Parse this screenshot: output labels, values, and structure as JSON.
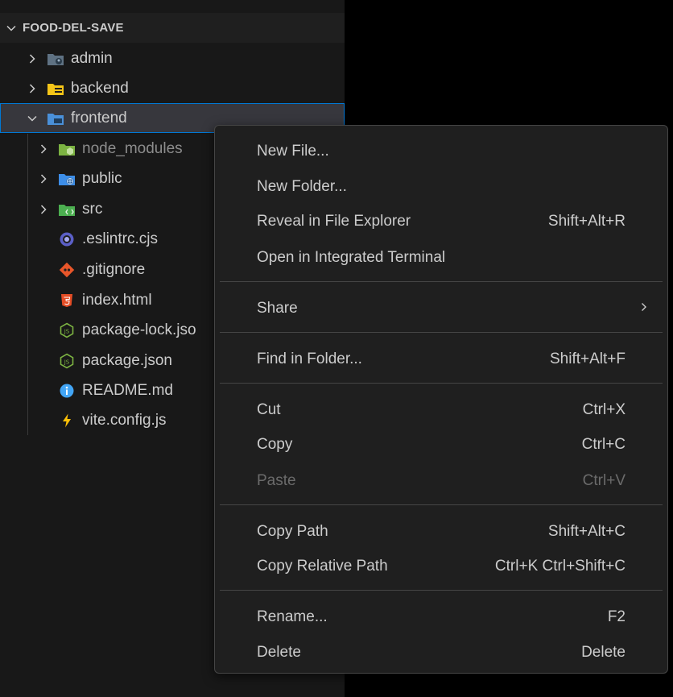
{
  "explorer": {
    "root_label": "FOOD-DEL-SAVE",
    "items": [
      {
        "label": "admin",
        "icon": "folder-admin-icon",
        "expanded": false
      },
      {
        "label": "backend",
        "icon": "folder-backend-icon",
        "expanded": false
      },
      {
        "label": "frontend",
        "icon": "folder-frontend-icon",
        "expanded": true,
        "selected": true
      },
      {
        "label": "node_modules",
        "icon": "folder-node-icon",
        "expanded": false
      },
      {
        "label": "public",
        "icon": "folder-public-icon",
        "expanded": false
      },
      {
        "label": "src",
        "icon": "folder-src-icon",
        "expanded": false
      },
      {
        "label": ".eslintrc.cjs",
        "icon": "eslint-icon"
      },
      {
        "label": ".gitignore",
        "icon": "git-icon"
      },
      {
        "label": "index.html",
        "icon": "html5-icon"
      },
      {
        "label": "package-lock.jso",
        "icon": "nodejs-icon"
      },
      {
        "label": "package.json",
        "icon": "nodejs-icon"
      },
      {
        "label": "README.md",
        "icon": "info-icon"
      },
      {
        "label": "vite.config.js",
        "icon": "vite-icon"
      }
    ]
  },
  "context_menu": {
    "items": [
      {
        "label": "New File...",
        "shortcut": ""
      },
      {
        "label": "New Folder...",
        "shortcut": ""
      },
      {
        "label": "Reveal in File Explorer",
        "shortcut": "Shift+Alt+R"
      },
      {
        "label": "Open in Integrated Terminal",
        "shortcut": ""
      },
      {
        "label": "Share",
        "shortcut": "",
        "submenu": true
      },
      {
        "label": "Find in Folder...",
        "shortcut": "Shift+Alt+F"
      },
      {
        "label": "Cut",
        "shortcut": "Ctrl+X"
      },
      {
        "label": "Copy",
        "shortcut": "Ctrl+C"
      },
      {
        "label": "Paste",
        "shortcut": "Ctrl+V",
        "disabled": true
      },
      {
        "label": "Copy Path",
        "shortcut": "Shift+Alt+C"
      },
      {
        "label": "Copy Relative Path",
        "shortcut": "Ctrl+K Ctrl+Shift+C"
      },
      {
        "label": "Rename...",
        "shortcut": "F2"
      },
      {
        "label": "Delete",
        "shortcut": "Delete"
      }
    ]
  },
  "colors": {
    "explorer_bg": "#181818",
    "menu_bg": "#1f1f1f",
    "selection_border": "#0078d4",
    "text": "#cccccc",
    "disabled_text": "#6b6b6b"
  }
}
